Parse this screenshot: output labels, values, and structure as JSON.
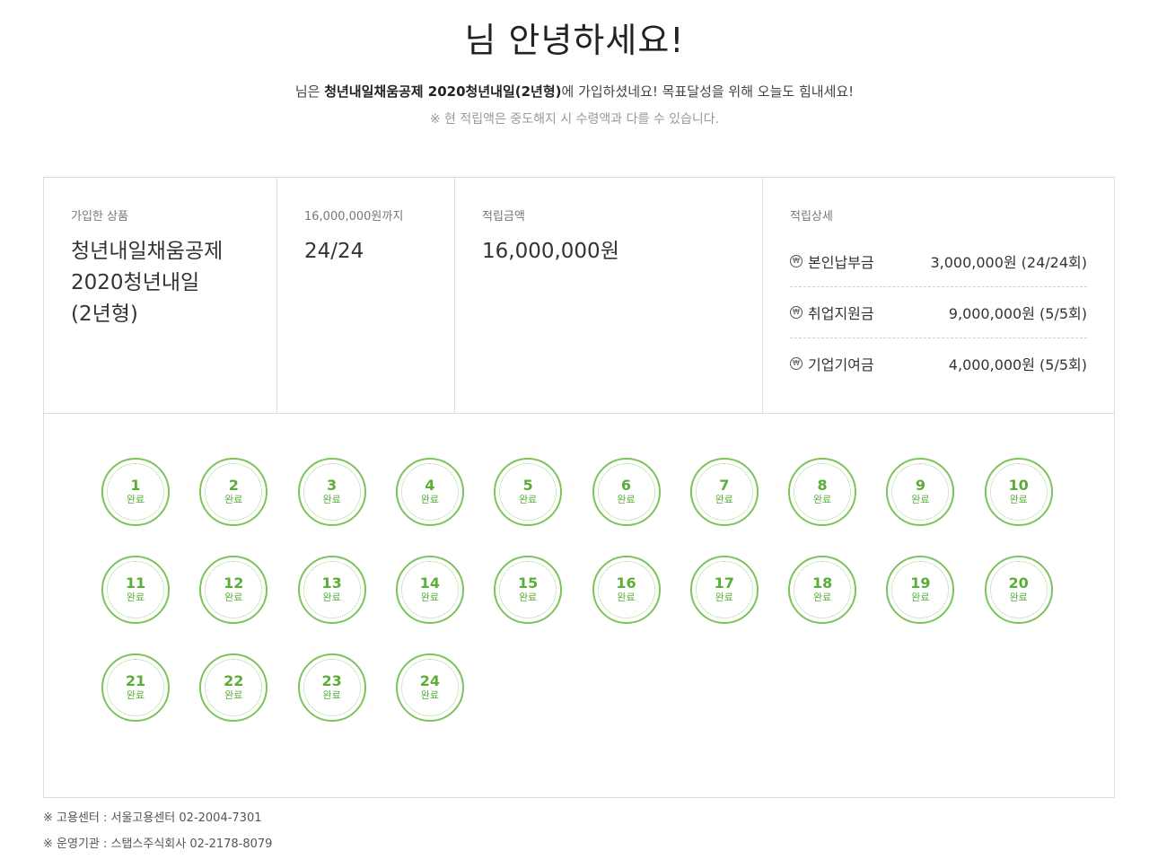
{
  "header": {
    "greeting": "님 안녕하세요!",
    "intro_prefix": "님은 ",
    "intro_product": "청년내일채움공제 2020청년내일(2년형)",
    "intro_suffix": "에 가입하셨네요! 목표달성을 위해 오늘도 힘내세요!",
    "notice": "※ 현 적립액은 중도해지 시 수령액과 다를 수 있습니다."
  },
  "summary": {
    "product_label": "가입한 상품",
    "product_lines": [
      "청년내일채움공제",
      "2020청년내일",
      "(2년형)"
    ],
    "progress_label": "16,000,000원까지",
    "progress_value": "24/24",
    "amount_label": "적립금액",
    "amount_value": "16,000,000원",
    "detail_label": "적립상세",
    "details": [
      {
        "icon": "won-icon",
        "name": "본인납부금",
        "value": "3,000,000원 (24/24회)"
      },
      {
        "icon": "won-icon",
        "name": "취업지원금",
        "value": "9,000,000원 (5/5회)"
      },
      {
        "icon": "won-icon",
        "name": "기업기여금",
        "value": "4,000,000원 (5/5회)"
      }
    ]
  },
  "rounds": {
    "status_label": "완료",
    "accent_color": "#7dc35b",
    "items": [
      "1",
      "2",
      "3",
      "4",
      "5",
      "6",
      "7",
      "8",
      "9",
      "10",
      "11",
      "12",
      "13",
      "14",
      "15",
      "16",
      "17",
      "18",
      "19",
      "20",
      "21",
      "22",
      "23",
      "24"
    ]
  },
  "footer": {
    "center": "※ 고용센터 : 서울고용센터 02-2004-7301",
    "operator": "※ 운영기관 : 스탭스주식회사 02-2178-8079"
  }
}
